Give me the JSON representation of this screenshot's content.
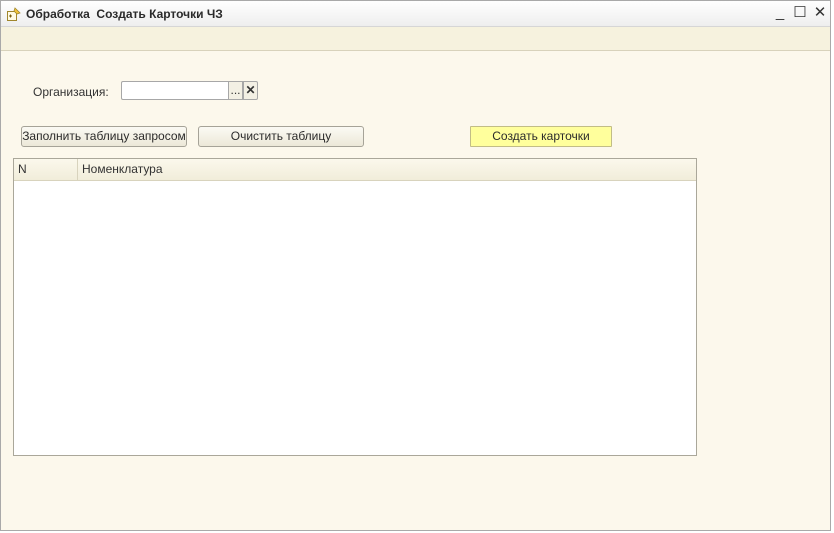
{
  "window": {
    "title": "Обработка  Создать Карточки ЧЗ",
    "minimize_glyph": "_",
    "maximize_glyph": "☐",
    "close_glyph": "✕"
  },
  "form": {
    "organization_label": "Организация:",
    "organization_value": "",
    "select_button_glyph": "...",
    "clear_button_glyph": "✕"
  },
  "buttons": {
    "fill_table": "Заполнить таблицу запросом",
    "clear_table": "Очистить таблицу",
    "create_cards": "Создать карточки"
  },
  "table": {
    "columns": [
      "N",
      "Номенклатура"
    ],
    "rows": []
  },
  "colors": {
    "background": "#fcf8ec",
    "create_button": "#ffff9c"
  },
  "icons": {
    "app": "processing-icon"
  }
}
